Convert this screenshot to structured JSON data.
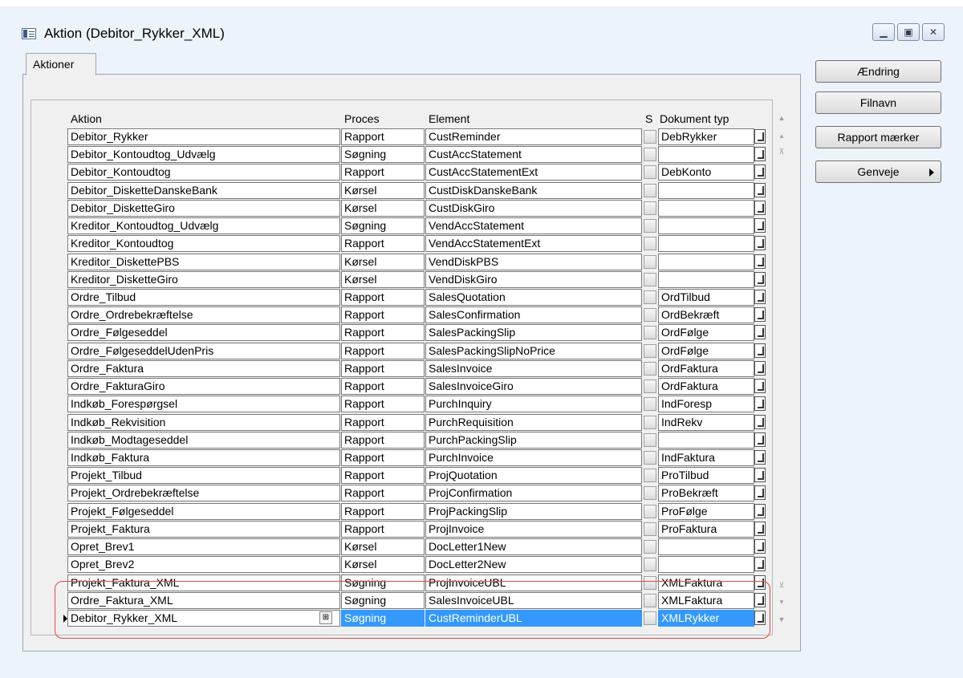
{
  "window": {
    "title": "Aktion (Debitor_Rykker_XML)"
  },
  "tabs": [
    {
      "label": "Aktioner"
    }
  ],
  "grid": {
    "columns": [
      "Aktion",
      "Proces",
      "Element",
      "S",
      "Dokument typ"
    ],
    "selected_index": 27,
    "rows": [
      {
        "aktion": "Debitor_Rykker",
        "proces": "Rapport",
        "element": "CustReminder",
        "dokument_typ": "DebRykker"
      },
      {
        "aktion": "Debitor_Kontoudtog_Udvælg",
        "proces": "Søgning",
        "element": "CustAccStatement",
        "dokument_typ": ""
      },
      {
        "aktion": "Debitor_Kontoudtog",
        "proces": "Rapport",
        "element": "CustAccStatementExt",
        "dokument_typ": "DebKonto"
      },
      {
        "aktion": "Debitor_DisketteDanskeBank",
        "proces": "Kørsel",
        "element": "CustDiskDanskeBank",
        "dokument_typ": ""
      },
      {
        "aktion": "Debitor_DisketteGiro",
        "proces": "Kørsel",
        "element": "CustDiskGiro",
        "dokument_typ": ""
      },
      {
        "aktion": "Kreditor_Kontoudtog_Udvælg",
        "proces": "Søgning",
        "element": "VendAccStatement",
        "dokument_typ": ""
      },
      {
        "aktion": "Kreditor_Kontoudtog",
        "proces": "Rapport",
        "element": "VendAccStatementExt",
        "dokument_typ": ""
      },
      {
        "aktion": "Kreditor_DiskettePBS",
        "proces": "Kørsel",
        "element": "VendDiskPBS",
        "dokument_typ": ""
      },
      {
        "aktion": "Kreditor_DisketteGiro",
        "proces": "Kørsel",
        "element": "VendDiskGiro",
        "dokument_typ": ""
      },
      {
        "aktion": "Ordre_Tilbud",
        "proces": "Rapport",
        "element": "SalesQuotation",
        "dokument_typ": "OrdTilbud"
      },
      {
        "aktion": "Ordre_Ordrebekræftelse",
        "proces": "Rapport",
        "element": "SalesConfirmation",
        "dokument_typ": "OrdBekræft"
      },
      {
        "aktion": "Ordre_Følgeseddel",
        "proces": "Rapport",
        "element": "SalesPackingSlip",
        "dokument_typ": "OrdFølge"
      },
      {
        "aktion": "Ordre_FølgeseddelUdenPris",
        "proces": "Rapport",
        "element": "SalesPackingSlipNoPrice",
        "dokument_typ": "OrdFølge"
      },
      {
        "aktion": "Ordre_Faktura",
        "proces": "Rapport",
        "element": "SalesInvoice",
        "dokument_typ": "OrdFaktura"
      },
      {
        "aktion": "Ordre_FakturaGiro",
        "proces": "Rapport",
        "element": "SalesInvoiceGiro",
        "dokument_typ": "OrdFaktura"
      },
      {
        "aktion": "Indkøb_Forespørgsel",
        "proces": "Rapport",
        "element": "PurchInquiry",
        "dokument_typ": "IndForesp"
      },
      {
        "aktion": "Indkøb_Rekvisition",
        "proces": "Rapport",
        "element": "PurchRequisition",
        "dokument_typ": "IndRekv"
      },
      {
        "aktion": "Indkøb_Modtageseddel",
        "proces": "Rapport",
        "element": "PurchPackingSlip",
        "dokument_typ": ""
      },
      {
        "aktion": "Indkøb_Faktura",
        "proces": "Rapport",
        "element": "PurchInvoice",
        "dokument_typ": "IndFaktura"
      },
      {
        "aktion": "Projekt_Tilbud",
        "proces": "Rapport",
        "element": "ProjQuotation",
        "dokument_typ": "ProTilbud"
      },
      {
        "aktion": "Projekt_Ordrebekræftelse",
        "proces": "Rapport",
        "element": "ProjConfirmation",
        "dokument_typ": "ProBekræft"
      },
      {
        "aktion": "Projekt_Følgeseddel",
        "proces": "Rapport",
        "element": "ProjPackingSlip",
        "dokument_typ": "ProFølge"
      },
      {
        "aktion": "Projekt_Faktura",
        "proces": "Rapport",
        "element": "ProjInvoice",
        "dokument_typ": "ProFaktura"
      },
      {
        "aktion": "Opret_Brev1",
        "proces": "Kørsel",
        "element": "DocLetter1New",
        "dokument_typ": ""
      },
      {
        "aktion": "Opret_Brev2",
        "proces": "Kørsel",
        "element": "DocLetter2New",
        "dokument_typ": ""
      },
      {
        "aktion": "Projekt_Faktura_XML",
        "proces": "Søgning",
        "element": "ProjInvoiceUBL",
        "dokument_typ": "XMLFaktura"
      },
      {
        "aktion": "Ordre_Faktura_XML",
        "proces": "Søgning",
        "element": "SalesInvoiceUBL",
        "dokument_typ": "XMLFaktura"
      },
      {
        "aktion": "Debitor_Rykker_XML",
        "proces": "Søgning",
        "element": "CustReminderUBL",
        "dokument_typ": "XMLRykker"
      }
    ]
  },
  "buttons": {
    "aendring": "Ændring",
    "filnavn": "Filnavn",
    "rapport_maerker": "Rapport mærker",
    "genveje": "Genveje"
  },
  "colors": {
    "selection": "#3399ff",
    "highlight_outline": "#e04848"
  }
}
